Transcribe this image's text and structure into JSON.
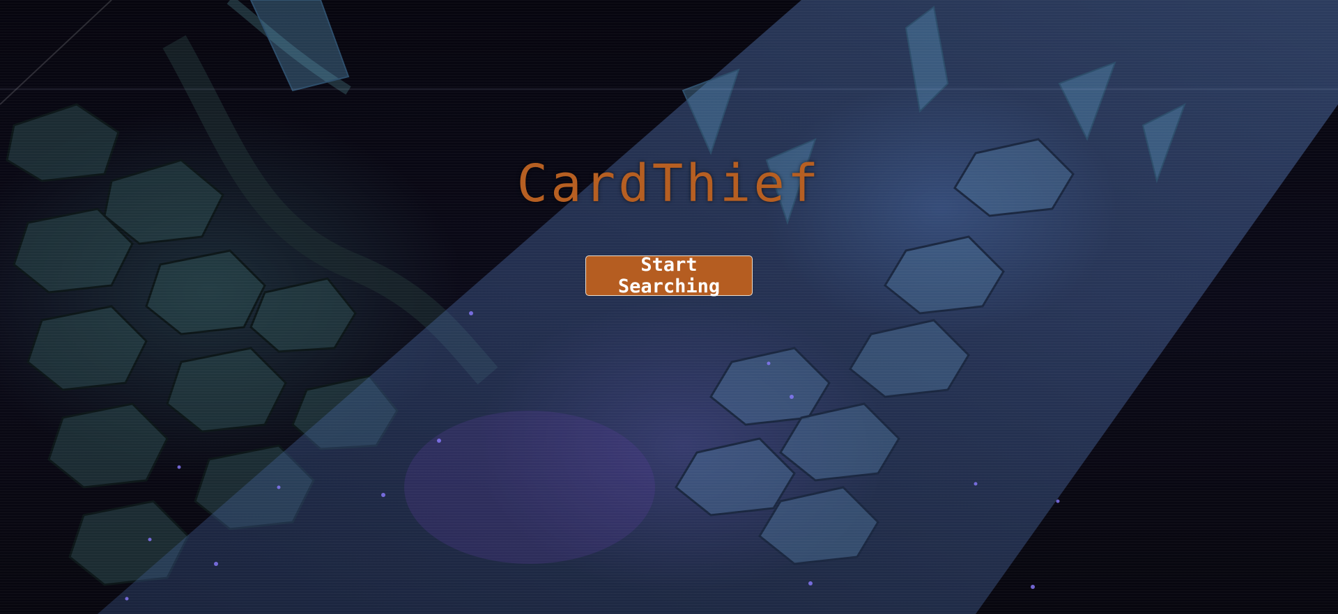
{
  "app": {
    "title": "CardThief"
  },
  "hero": {
    "cta_label": "Start Searching"
  },
  "colors": {
    "accent": "#b55d21",
    "title": "#b65f22",
    "button_border": "#efe1cf",
    "background": "#05040c"
  }
}
